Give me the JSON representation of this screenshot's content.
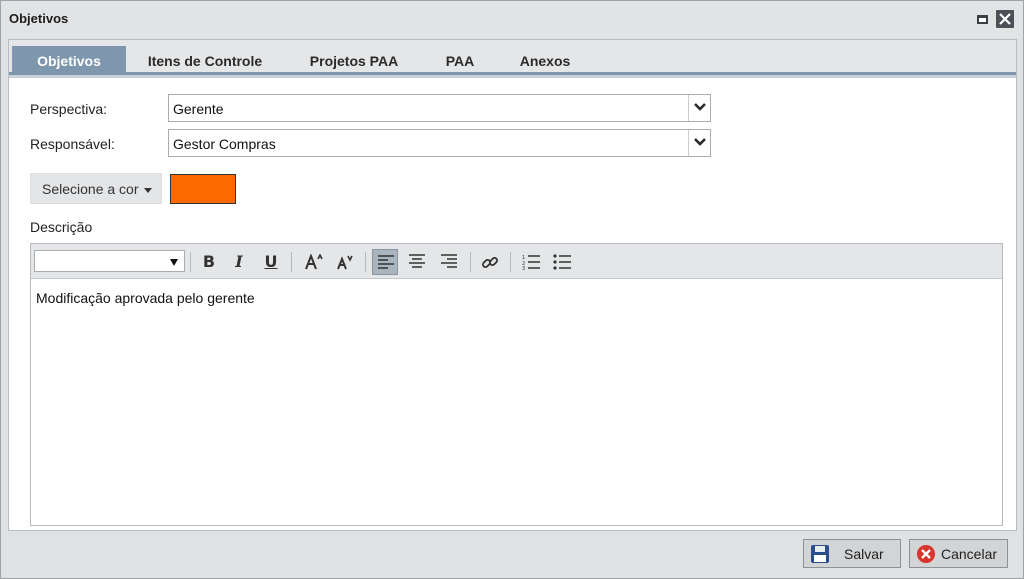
{
  "window": {
    "title": "Objetivos",
    "icons": {
      "maximize": "maximize-icon",
      "close": "close-icon"
    }
  },
  "tabs": [
    {
      "label": "Objetivos",
      "active": true
    },
    {
      "label": "Itens de Controle",
      "active": false
    },
    {
      "label": "Projetos PAA",
      "active": false
    },
    {
      "label": "PAA",
      "active": false
    },
    {
      "label": "Anexos",
      "active": false
    }
  ],
  "form": {
    "perspectiva_label": "Perspectiva:",
    "perspectiva_value": "Gerente",
    "responsavel_label": "Responsável:",
    "responsavel_value": "Gestor Compras",
    "color_button_label": "Selecione a cor",
    "selected_color": "#ff6a00",
    "descricao_label": "Descrição"
  },
  "editor": {
    "font_value": "",
    "toolbar_icons": [
      "bold-icon",
      "italic-icon",
      "underline-icon",
      "font-size-increase-icon",
      "font-size-decrease-icon",
      "align-left-icon",
      "align-center-icon",
      "align-right-icon",
      "link-icon",
      "ordered-list-icon",
      "unordered-list-icon"
    ],
    "bold_glyph": "B",
    "italic_glyph": "I",
    "underline_glyph": "U",
    "content": "Modificação aprovada pelo gerente"
  },
  "footer": {
    "save_label": "Salvar",
    "cancel_label": "Cancelar"
  },
  "colors": {
    "tab_active": "#7f97ad",
    "swatch": "#ff6a00",
    "cancel_icon": "#d9342b",
    "save_icon": "#2a4e8c"
  }
}
